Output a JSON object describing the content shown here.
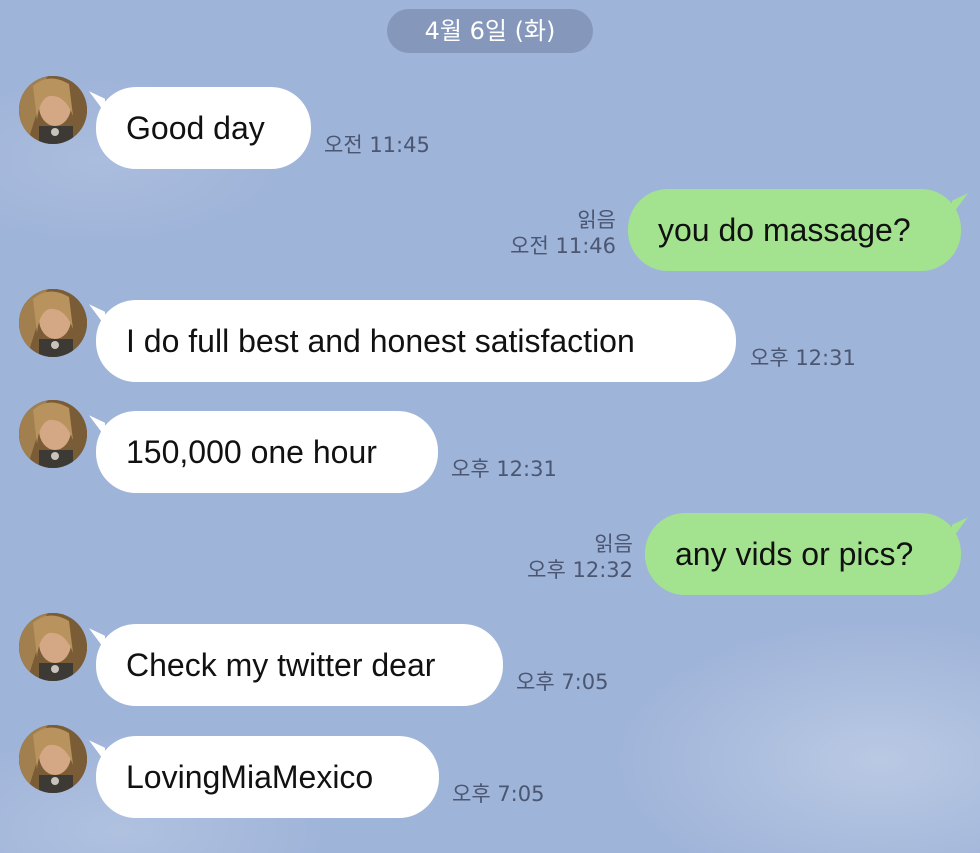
{
  "date_separator": "4월 6일 (화)",
  "read_label": "읽음",
  "messages": [
    {
      "direction": "in",
      "text": "Good day",
      "time": "오전 11:45"
    },
    {
      "direction": "out",
      "text": "you do massage?",
      "time": "오전 11:46",
      "read": "읽음"
    },
    {
      "direction": "in",
      "text": "I do full best and honest satisfaction",
      "time": "오후 12:31"
    },
    {
      "direction": "in",
      "text": "150,000 one hour",
      "time": "오후 12:31"
    },
    {
      "direction": "out",
      "text": "any vids or pics?",
      "time": "오후 12:32",
      "read": "읽음"
    },
    {
      "direction": "in",
      "text": "Check my twitter dear",
      "time": "오후 7:05"
    },
    {
      "direction": "in",
      "text": "LovingMiaMexico",
      "time": "오후 7:05"
    }
  ],
  "colors": {
    "background": "#9fb4d9",
    "incoming_bubble": "#ffffff",
    "outgoing_bubble": "#a3e38f",
    "meta_text": "#4a5672"
  }
}
